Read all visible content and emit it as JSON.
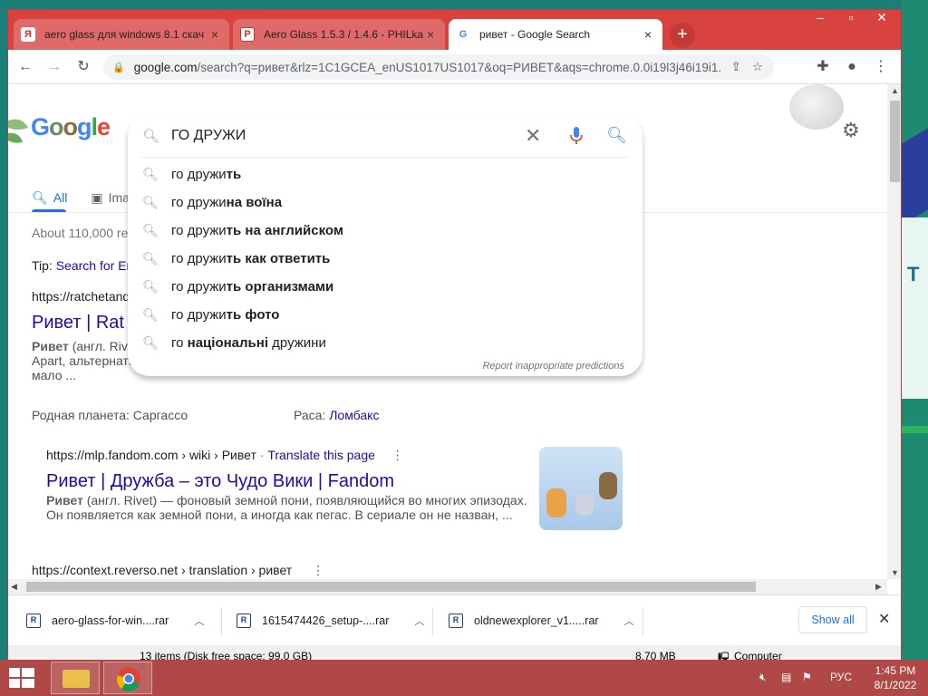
{
  "browser": {
    "tabs": [
      {
        "favicon": "Я",
        "title": "aero glass для windows 8.1 скач",
        "close": "×"
      },
      {
        "favicon": "P",
        "title": "Aero Glass 1.5.3 / 1.4.6 - PHILka",
        "close": "×"
      },
      {
        "favicon": "G",
        "title": "ривет - Google Search",
        "close": "×"
      }
    ],
    "new_tab": "+",
    "url_host": "google.com",
    "url_rest": "/search?q=ривет&rlz=1C1GCEA_enUS1017US1017&oq=РИВЕТ&aqs=chrome.0.0i19l3j46i19i1..."
  },
  "google": {
    "logo": "Google",
    "search_query": "ГО ДРУЖИ",
    "suggestions": [
      {
        "prefix": "го дружи",
        "bold": "ть",
        "suffix": ""
      },
      {
        "prefix": "го дружи",
        "bold": "на воїна",
        "suffix": ""
      },
      {
        "prefix": "го дружи",
        "bold": "ть на английском",
        "suffix": ""
      },
      {
        "prefix": "го дружи",
        "bold": "ть как ответить",
        "suffix": ""
      },
      {
        "prefix": "го дружи",
        "bold": "ть организмами",
        "suffix": ""
      },
      {
        "prefix": "го дружи",
        "bold": "ть фото",
        "suffix": ""
      },
      {
        "prefix": "го ",
        "bold": "національні",
        "suffix": " дружини"
      }
    ],
    "report_link": "Report inappropriate predictions",
    "tabs": {
      "all": "All",
      "images": "Ima"
    },
    "stats": "About 110,000 re",
    "tip_prefix": "Tip: ",
    "tip_link": "Search for En",
    "results": [
      {
        "cite": "https://ratchetand",
        "title": "Ривет | Rat",
        "snippet1_bold": "Ривет",
        "snippet1": " (англ. Riv",
        "snippet2": "Apart, альтернати",
        "snippet3": "мало ...",
        "fact1_label": "Родная планета: ",
        "fact1_value": "Саргассо",
        "fact2_label": "Раса: ",
        "fact2_value": "Ломбакс"
      },
      {
        "cite": "https://mlp.fandom.com › wiki › Ривет",
        "translate": "Translate this page",
        "title": "Ривет | Дружба – это Чудо Вики | Fandom",
        "snippet_bold": "Ривет",
        "snippet1": " (англ. Rivet) — фоновый земной пони, появляющийся во многих эпизодах.",
        "snippet2": "Он появляется как земной пони, а иногда как пегас. В сериале он не назван, ..."
      },
      {
        "cite": "https://context.reverso.net › translation › ривет"
      }
    ]
  },
  "downloads": {
    "items": [
      {
        "name": "aero-glass-for-win....rar"
      },
      {
        "name": "1615474426_setup-....rar"
      },
      {
        "name": "oldnewexplorer_v1.....rar"
      }
    ],
    "show_all": "Show all"
  },
  "explorer_status": {
    "items": "13 items (Disk free space: 99.0 GB)",
    "size": "8.70 MB",
    "location": "Computer"
  },
  "taskbar": {
    "lang": "РУС",
    "time": "1:45 PM",
    "date": "8/1/2022"
  }
}
